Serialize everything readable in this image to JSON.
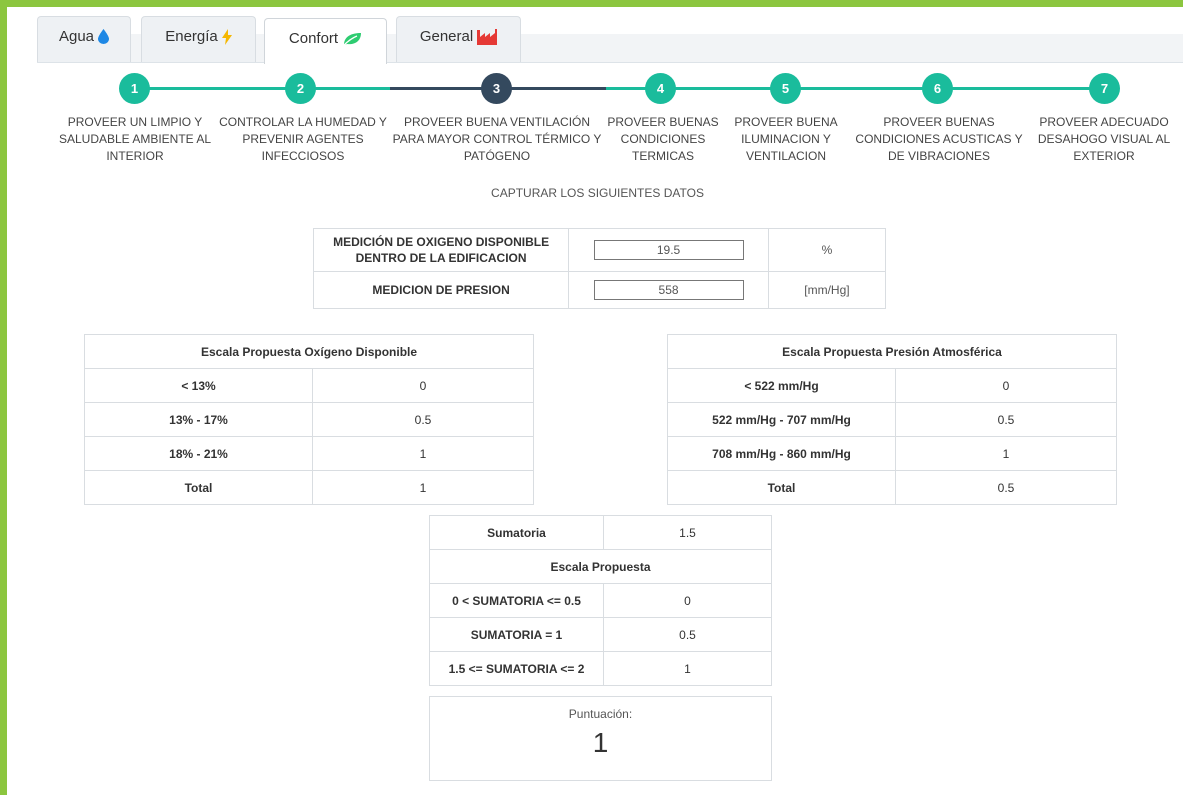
{
  "tabs": [
    {
      "label": "Agua",
      "icon": "water-drop-icon",
      "color": "#1e88e5",
      "active": false
    },
    {
      "label": "Energía",
      "icon": "lightning-icon",
      "color": "#f5b700",
      "active": false
    },
    {
      "label": "Confort",
      "icon": "leaf-icon",
      "color": "#2ecc71",
      "active": true
    },
    {
      "label": "General",
      "icon": "factory-icon",
      "color": "#e53935",
      "active": false
    }
  ],
  "colors": {
    "accent": "#1abc9c",
    "current_step": "#34495e",
    "frame": "#8cc63f"
  },
  "steps": [
    {
      "number": "1",
      "lines": [
        "PROVEER UN LIMPIO Y",
        "SALUDABLE AMBIENTE AL",
        "INTERIOR"
      ]
    },
    {
      "number": "2",
      "lines": [
        "CONTROLAR LA HUMEDAD Y",
        "PREVENIR AGENTES",
        "INFECCIOSOS"
      ]
    },
    {
      "number": "3",
      "lines": [
        "PROVEER BUENA VENTILACIÓN",
        "PARA MAYOR CONTROL TÉRMICO Y",
        "PATÓGENO"
      ]
    },
    {
      "number": "4",
      "lines": [
        "PROVEER BUENAS",
        "CONDICIONES",
        "TERMICAS"
      ]
    },
    {
      "number": "5",
      "lines": [
        "PROVEER BUENA",
        "ILUMINACION Y",
        "VENTILACION"
      ]
    },
    {
      "number": "6",
      "lines": [
        "PROVEER BUENAS",
        "CONDICIONES ACUSTICAS Y",
        "DE VIBRACIONES"
      ]
    },
    {
      "number": "7",
      "lines": [
        "PROVEER ADECUADO",
        "DESAHOGO VISUAL AL",
        "EXTERIOR"
      ]
    }
  ],
  "current_step": 3,
  "capture_title": "CAPTURAR LOS SIGUIENTES DATOS",
  "inputs": {
    "oxygen": {
      "label_line1": "MEDICIÓN DE OXIGENO DISPONIBLE",
      "label_line2": "DENTRO DE LA EDIFICACION",
      "value": "19.5",
      "unit": "%"
    },
    "pressure": {
      "label": "MEDICION DE PRESION",
      "value": "558",
      "unit": "[mm/Hg]"
    }
  },
  "oxygen_scale": {
    "title": "Escala Propuesta Oxígeno Disponible",
    "rows": [
      {
        "range": "< 13%",
        "score": "0"
      },
      {
        "range": "13% - 17%",
        "score": "0.5"
      },
      {
        "range": "18% - 21%",
        "score": "1"
      },
      {
        "range": "Total",
        "score": "1"
      }
    ]
  },
  "pressure_scale": {
    "title": "Escala Propuesta Presión Atmosférica",
    "rows": [
      {
        "range": "< 522 mm/Hg",
        "score": "0"
      },
      {
        "range": "522 mm/Hg - 707 mm/Hg",
        "score": "0.5"
      },
      {
        "range": "708 mm/Hg - 860 mm/Hg",
        "score": "1"
      },
      {
        "range": "Total",
        "score": "0.5"
      }
    ]
  },
  "summary": {
    "sum_label": "Sumatoria",
    "sum_value": "1.5",
    "scale_title": "Escala Propuesta",
    "rows": [
      {
        "range": "0 < SUMATORIA <= 0.5",
        "score": "0"
      },
      {
        "range": "SUMATORIA = 1",
        "score": "0.5"
      },
      {
        "range": "1.5 <= SUMATORIA <= 2",
        "score": "1"
      }
    ]
  },
  "score": {
    "label": "Puntuación:",
    "value": "1"
  }
}
